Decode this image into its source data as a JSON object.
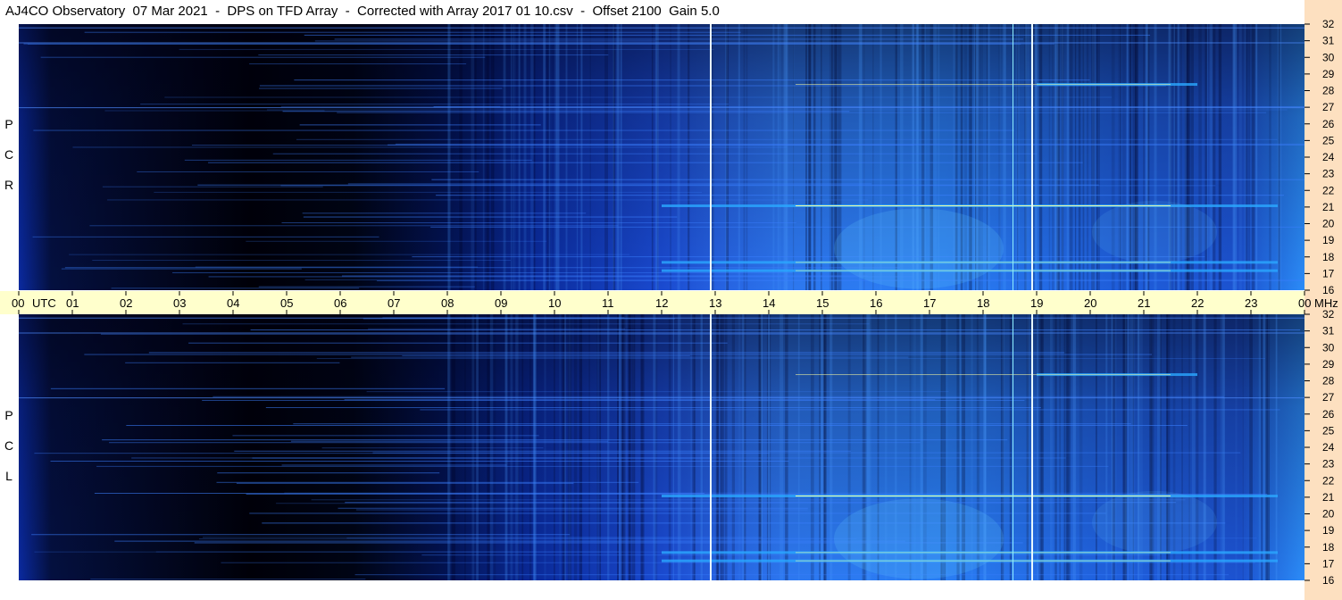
{
  "title": "AJ4CO Observatory  07 Mar 2021  -  DPS on TFD Array  -  Corrected with Array 2017 01 10.csv  -  Offset 2100  Gain 5.0",
  "panels": [
    {
      "label": [
        "R",
        "C",
        "P"
      ]
    },
    {
      "label": [
        "L",
        "C",
        "P"
      ]
    }
  ],
  "colors": {
    "background": "#000010",
    "mid": "#0a3cc8",
    "bright": "#2aa8ff",
    "hot": "#ffffa0",
    "time_bar": "#ffffcc",
    "freq_bar": "#fde0c0",
    "grid_line": "#4f8bff"
  },
  "chart_data": {
    "type": "heatmap",
    "x_axis": {
      "unit_label": "UTC",
      "ticks": [
        "00",
        "01",
        "02",
        "03",
        "04",
        "05",
        "06",
        "07",
        "08",
        "09",
        "10",
        "11",
        "12",
        "13",
        "14",
        "15",
        "16",
        "17",
        "18",
        "19",
        "20",
        "21",
        "22",
        "23",
        "00"
      ],
      "range": [
        0,
        24
      ]
    },
    "y_axis": {
      "unit_label": "MHz",
      "ticks": [
        "32",
        "31",
        "30",
        "29",
        "28",
        "27",
        "26",
        "25",
        "24",
        "23",
        "22",
        "21",
        "20",
        "19",
        "18",
        "17",
        "16"
      ],
      "range": [
        16,
        32
      ]
    },
    "series": [
      {
        "name": "RCP"
      },
      {
        "name": "LCP"
      }
    ],
    "vertical_markers_utc": [
      12.9,
      18.55,
      18.9
    ],
    "horizontal_bright_bands_mhz": [
      21.1,
      17.7,
      17.2,
      28.4
    ]
  }
}
